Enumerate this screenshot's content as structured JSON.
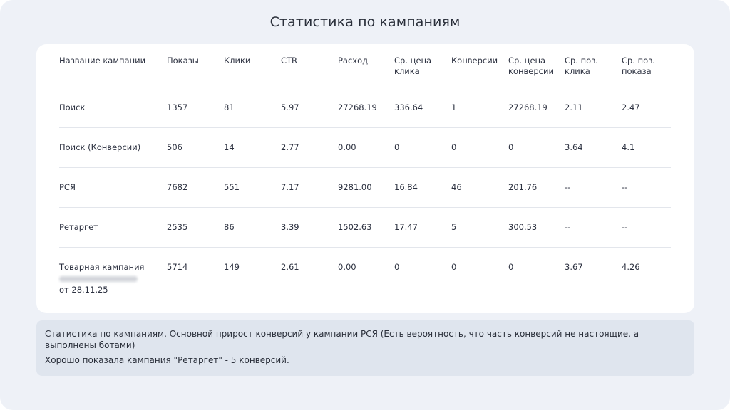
{
  "title": "Статистика по кампаниям",
  "table": {
    "headers": [
      "Название кампании",
      "Показы",
      "Клики",
      "CTR",
      "Расход",
      "Ср. цена клика",
      "Конверсии",
      "Ср. цена конверсии",
      "Ср. поз. клика",
      "Ср. поз. показа"
    ],
    "rows": [
      [
        "Поиск",
        "1357",
        "81",
        "5.97",
        "27268.19",
        "336.64",
        "1",
        "27268.19",
        "2.11",
        "2.47"
      ],
      [
        "Поиск (Конверсии)",
        "506",
        "14",
        "2.77",
        "0.00",
        "0",
        "0",
        "0",
        "3.64",
        "4.1"
      ],
      [
        "РСЯ",
        "7682",
        "551",
        "7.17",
        "9281.00",
        "16.84",
        "46",
        "201.76",
        "--",
        "--"
      ],
      [
        "Ретаргет",
        "2535",
        "86",
        "3.39",
        "1502.63",
        "17.47",
        "5",
        "300.53",
        "--",
        "--"
      ],
      [
        "Товарная кампания",
        "5714",
        "149",
        "2.61",
        "0.00",
        "0",
        "0",
        "0",
        "3.67",
        "4.26"
      ]
    ],
    "last_row_name_suffix": "от 28.11.25"
  },
  "note": {
    "line1": "Статистика по кампаниям. Основной прирост конверсий у кампании РСЯ (Есть вероятность, что часть конверсий не настоящие, а выполнены ботами)",
    "line2": "Хорошо показала кампания \"Ретаргет\" - 5 конверсий."
  },
  "colors": {
    "background": "#eef1f7",
    "card": "#ffffff",
    "note_bg": "#dfe5ee",
    "text": "#2c3140"
  }
}
